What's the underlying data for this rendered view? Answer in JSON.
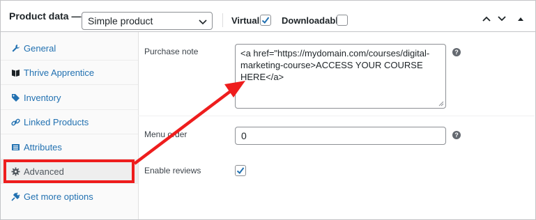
{
  "header": {
    "title": "Product data —",
    "product_type": "Simple product",
    "virtual_label": "Virtual:",
    "virtual_checked": true,
    "downloadable_label": "Downloadable:",
    "downloadable_checked": false
  },
  "sidebar": {
    "items": [
      {
        "label": "General",
        "icon": "wrench-icon"
      },
      {
        "label": "Thrive Apprentice",
        "icon": "book-icon"
      },
      {
        "label": "Inventory",
        "icon": "tag-icon"
      },
      {
        "label": "Linked Products",
        "icon": "link-icon"
      },
      {
        "label": "Attributes",
        "icon": "table-icon"
      },
      {
        "label": "Advanced",
        "icon": "gear-icon",
        "active": true
      },
      {
        "label": "Get more options",
        "icon": "plugin-icon"
      }
    ]
  },
  "fields": {
    "purchase_note_label": "Purchase note",
    "purchase_note_value": "<a href=\"https://mydomain.com/courses/digital-marketing-course>ACCESS YOUR COURSE HERE</a>",
    "menu_order_label": "Menu order",
    "menu_order_value": "0",
    "enable_reviews_label": "Enable reviews",
    "enable_reviews_checked": true
  },
  "colors": {
    "link": "#2271b1",
    "annotation_red": "#ee1d1d",
    "checkbox_blue": "#2271b1"
  }
}
